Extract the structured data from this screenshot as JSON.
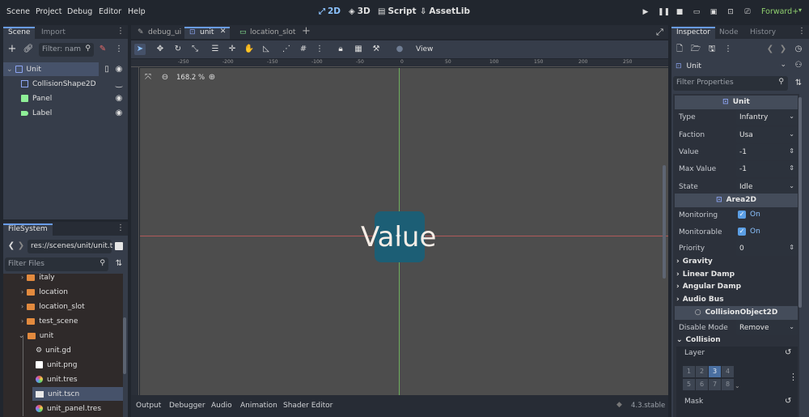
{
  "menubar": {
    "items": [
      "Scene",
      "Project",
      "Debug",
      "Editor",
      "Help"
    ],
    "workspaces": [
      "2D",
      "3D",
      "Script",
      "AssetLib"
    ],
    "renderer": "Forward+"
  },
  "scene_dock": {
    "tabs": [
      "Scene",
      "Import"
    ],
    "filter_placeholder": "Filter: nam",
    "nodes": [
      {
        "name": "Unit",
        "type": "root"
      },
      {
        "name": "CollisionShape2D",
        "type": "collision"
      },
      {
        "name": "Panel",
        "type": "panel"
      },
      {
        "name": "Label",
        "type": "label"
      }
    ]
  },
  "filesystem": {
    "tab": "FileSystem",
    "path": "res://scenes/unit/unit.t",
    "filter_placeholder": "Filter Files",
    "items": [
      {
        "name": "italy",
        "kind": "folder"
      },
      {
        "name": "location",
        "kind": "folder"
      },
      {
        "name": "location_slot",
        "kind": "folder"
      },
      {
        "name": "test_scene",
        "kind": "folder"
      },
      {
        "name": "unit",
        "kind": "folder"
      },
      {
        "name": "unit.gd",
        "kind": "script"
      },
      {
        "name": "unit.png",
        "kind": "image"
      },
      {
        "name": "unit.tres",
        "kind": "resource"
      },
      {
        "name": "unit.tscn",
        "kind": "scene"
      },
      {
        "name": "unit_panel.tres",
        "kind": "resource"
      }
    ]
  },
  "editor": {
    "tabs": [
      "debug_ui",
      "unit",
      "location_slot"
    ],
    "view_label": "View",
    "zoom": "168.2 %",
    "ruler_labels": [
      "-250",
      "-200",
      "-150",
      "-100",
      "-50",
      "0",
      "50",
      "100",
      "150",
      "200",
      "250"
    ],
    "canvas_label": "Value"
  },
  "bottom_panel": {
    "tabs": [
      "Output",
      "Debugger",
      "Audio",
      "Animation",
      "Shader Editor"
    ],
    "version": "4.3.stable"
  },
  "inspector": {
    "tabs": [
      "Inspector",
      "Node",
      "History"
    ],
    "object": "Unit",
    "filter_placeholder": "Filter Properties",
    "section_unit": "Unit",
    "props": [
      {
        "label": "Type",
        "value": "Infantry",
        "widget": "dropdown"
      },
      {
        "label": "Faction",
        "value": "Usa",
        "widget": "dropdown"
      },
      {
        "label": "Value",
        "value": "-1",
        "widget": "spin"
      },
      {
        "label": "Max Value",
        "value": "-1",
        "widget": "spin"
      },
      {
        "label": "State",
        "value": "Idle",
        "widget": "dropdown"
      }
    ],
    "section_area": "Area2D",
    "area_props": [
      {
        "label": "Monitoring",
        "value": "On"
      },
      {
        "label": "Monitorable",
        "value": "On"
      }
    ],
    "priority": {
      "label": "Priority",
      "value": "0"
    },
    "groups": [
      "Gravity",
      "Linear Damp",
      "Angular Damp",
      "Audio Bus"
    ],
    "section_collision_obj": "CollisionObject2D",
    "disable_mode": {
      "label": "Disable Mode",
      "value": "Remove"
    },
    "collision_group": "Collision",
    "layer_label": "Layer",
    "layer_cells": [
      "1",
      "2",
      "3",
      "4",
      "5",
      "6",
      "7",
      "8"
    ],
    "mask_label": "Mask"
  },
  "colors": {
    "accent": "#699ce8",
    "folder": "#e28a3e",
    "canvas_bg": "#4d4d4d",
    "panel_node": "#1c5e75",
    "renderer_green": "#8fcf6e"
  }
}
